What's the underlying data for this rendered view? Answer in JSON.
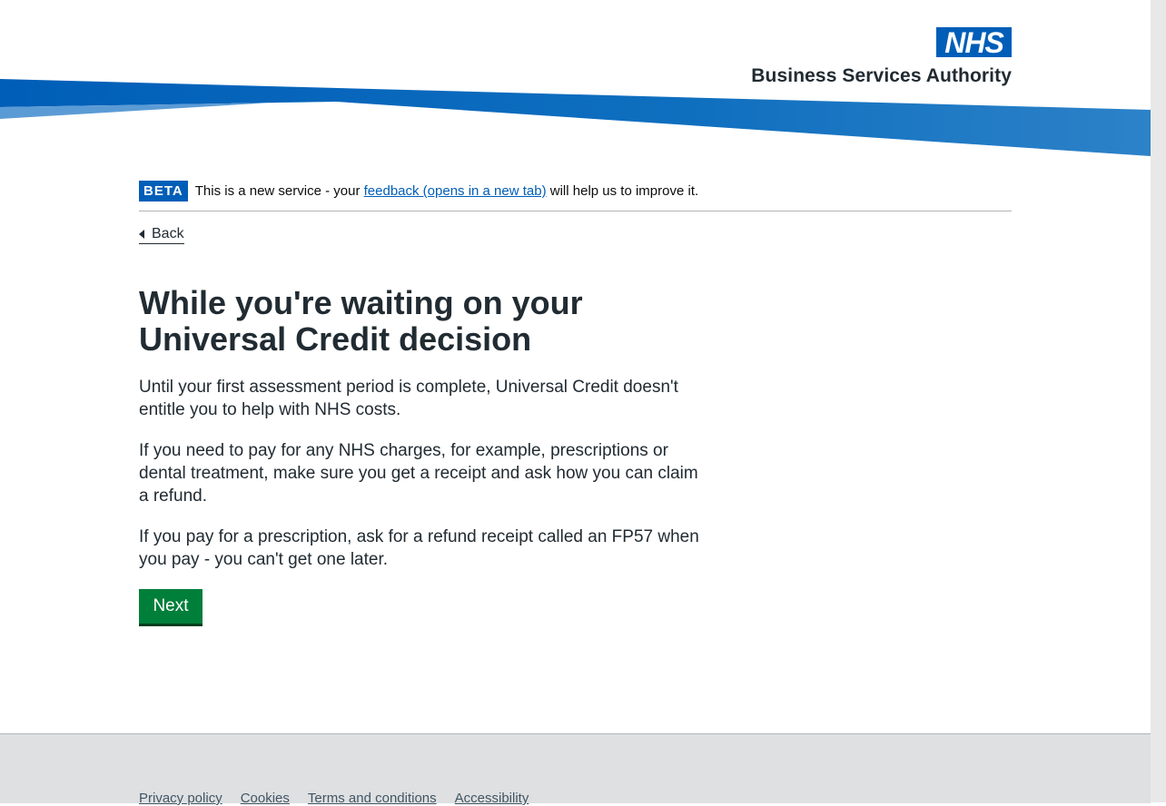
{
  "header": {
    "logo_mark": "NHS",
    "logo_text": "Business Services Authority",
    "brand_color": "#005eb8",
    "swoosh_colors": [
      "#005eb8",
      "#2d82c8",
      "#5b9bd5"
    ]
  },
  "beta_banner": {
    "tag": "BETA",
    "text_before": "This is a new service - your ",
    "link_text": "feedback (opens in a new tab)",
    "text_after": " will help us to improve it."
  },
  "back_link": {
    "label": "Back"
  },
  "main": {
    "heading": "While you're waiting on your Universal Credit decision",
    "paragraphs": [
      "Until your first assessment period is complete, Universal Credit doesn't entitle you to help with NHS costs.",
      "If you need to pay for any NHS charges, for example, prescriptions or dental treatment, make sure you get a receipt and ask how you can claim a refund.",
      "If you pay for a prescription, ask for a refund receipt called an FP57 when you pay - you can't get one later."
    ],
    "next_button": "Next",
    "button_color": "#007f3b"
  },
  "footer": {
    "links": [
      "Privacy policy",
      "Cookies",
      "Terms and conditions",
      "Accessibility"
    ]
  }
}
